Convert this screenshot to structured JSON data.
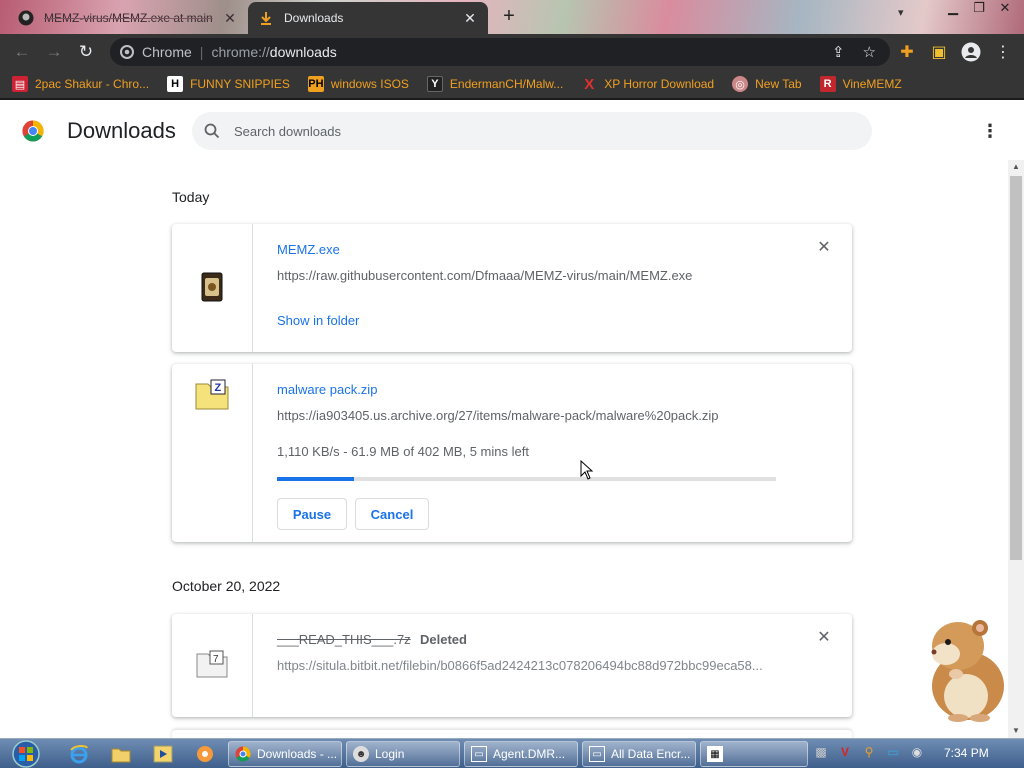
{
  "tabs": [
    {
      "title": "MEMZ-virus/MEMZ.exe at main",
      "icon": "github-icon"
    },
    {
      "title": "Downloads",
      "icon": "download-icon"
    }
  ],
  "toolbar": {
    "host": "Chrome",
    "url_prefix": "chrome://",
    "url_path": "downloads"
  },
  "bookmarks": [
    {
      "label": "2pac Shakur - Chro...",
      "icon": "bookmark-favicon"
    },
    {
      "label": "FUNNY SNIPPIES",
      "icon": "h-favicon"
    },
    {
      "label": "windows ISOS",
      "icon": "ph-favicon"
    },
    {
      "label": "EndermanCH/Malw...",
      "icon": "yp-favicon"
    },
    {
      "label": "XP Horror Download",
      "icon": "x-favicon"
    },
    {
      "label": "New Tab",
      "icon": "globe-favicon"
    },
    {
      "label": "VineMEMZ",
      "icon": "r-favicon"
    }
  ],
  "page": {
    "title": "Downloads",
    "search_placeholder": "Search downloads"
  },
  "sections": [
    {
      "date": "Today",
      "items": [
        {
          "filename": "MEMZ.exe",
          "url": "https://raw.githubusercontent.com/Dfmaaa/MEMZ-virus/main/MEMZ.exe",
          "action": "Show in folder",
          "icon": "exe-file-icon"
        },
        {
          "filename": "malware pack.zip",
          "url": "https://ia903405.us.archive.org/27/items/malware-pack/malware%20pack.zip",
          "status": "1,110 KB/s - 61.9 MB of 402 MB, 5 mins left",
          "progress": 0.154,
          "buttons": [
            "Pause",
            "Cancel"
          ],
          "icon": "zip-file-icon"
        }
      ]
    },
    {
      "date": "October 20, 2022",
      "items": [
        {
          "filename": "___READ_THIS___.7z",
          "tag": "Deleted",
          "url": "https://situla.bitbit.net/filebin/b0866f5ad2424213c078206494bc88d972bbc99eca58...",
          "icon": "unknown-file-icon"
        }
      ]
    }
  ],
  "taskbar": {
    "windows": [
      {
        "label": "Downloads - ...",
        "icon": "chrome-icon"
      },
      {
        "label": "Login",
        "icon": "app-icon"
      },
      {
        "label": "Agent.DMR...",
        "icon": "window-icon"
      },
      {
        "label": "All Data Encr...",
        "icon": "window-icon"
      },
      {
        "label": "",
        "icon": "app-icon"
      }
    ],
    "clock": "7:34 PM"
  },
  "colors": {
    "accent": "#1a73e8",
    "chrome_dark": "#353535",
    "bookmark_text": "#f0a020"
  }
}
